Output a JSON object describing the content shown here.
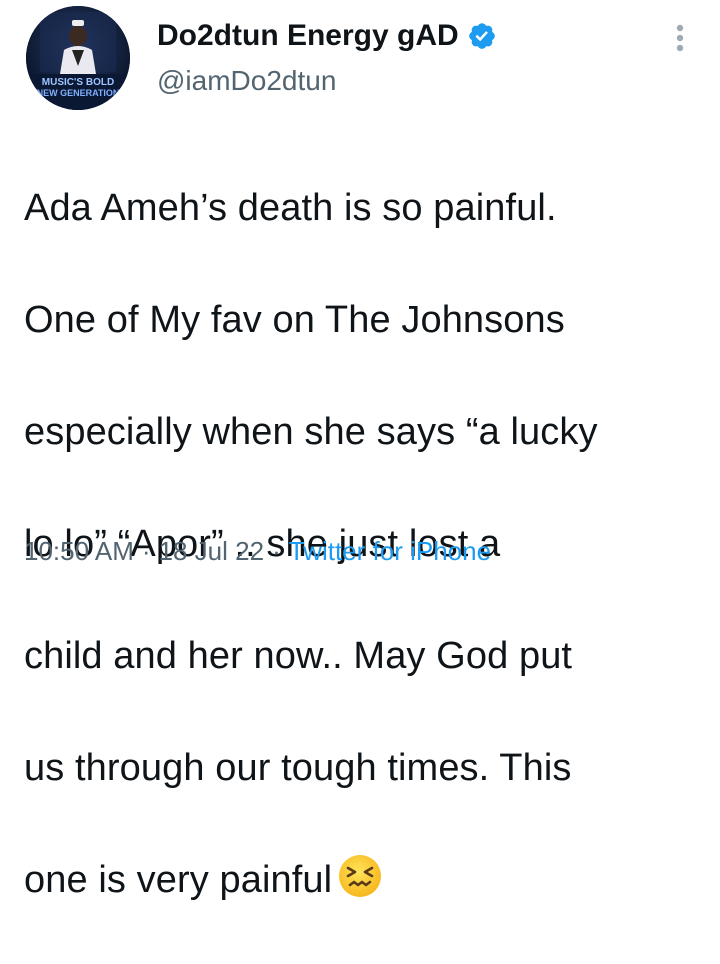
{
  "author": {
    "display_name": "Do2dtun Energy gAD",
    "handle": "@iamDo2dtun",
    "verified": true,
    "avatar_caption_line1": "MUSIC'S BOLD",
    "avatar_caption_line2": "NEW GENERATION"
  },
  "tweet": {
    "lines": [
      "Ada Ameh’s death is so painful.",
      "One of My fav on The Johnsons",
      "especially when she says “a lucky",
      "lo lo” “Apor” .. she just lost a",
      "child and her now.. May God put",
      "us through our tough times. This",
      "one is very painful"
    ],
    "emoji": "confounded-face-emoji"
  },
  "meta": {
    "time": "10:50 AM",
    "separator": "·",
    "date": "18 Jul 22",
    "source": "Twitter for iPhone"
  },
  "colors": {
    "text": "#0f1419",
    "secondary": "#536471",
    "accent": "#1d9bf0"
  },
  "icons": {
    "verified": "verified-badge-icon",
    "more": "more-options-icon"
  }
}
